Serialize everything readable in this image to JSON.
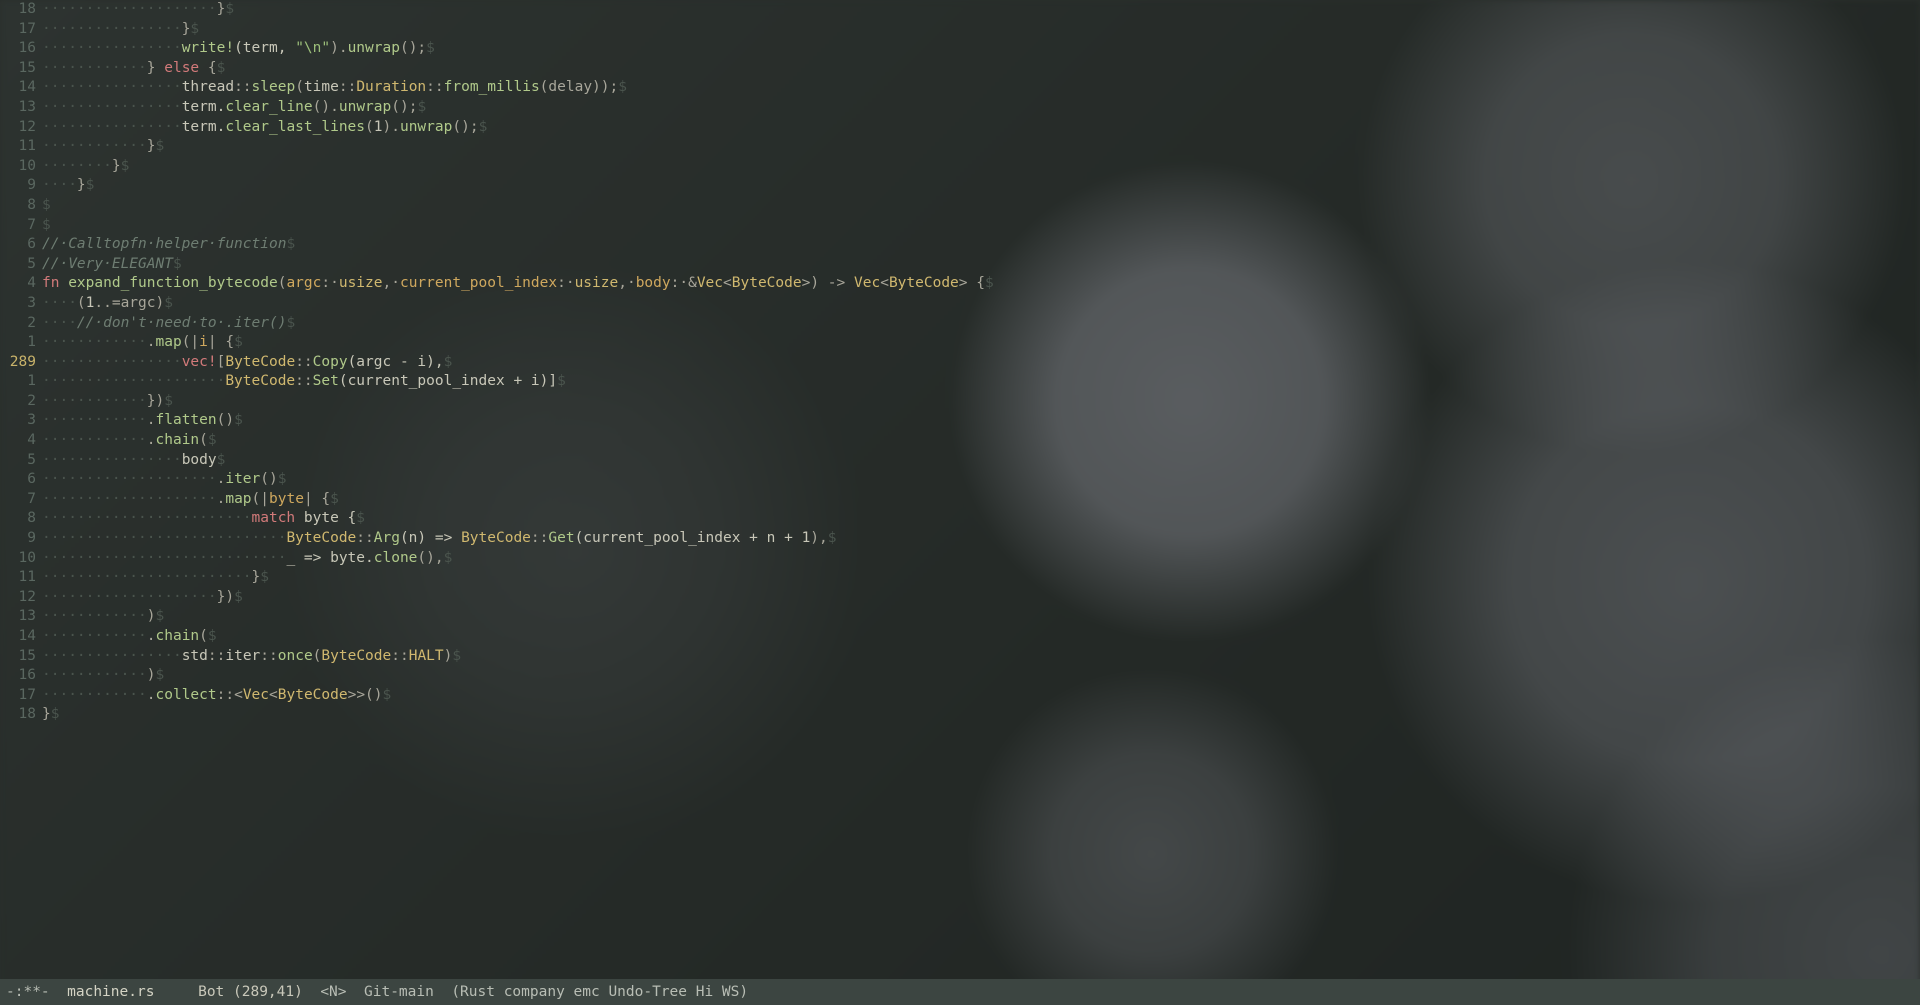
{
  "modeline": {
    "modified": "-:**-",
    "filename": "machine.rs",
    "position": "Bot (289,41)",
    "mode_indicator": "<N>",
    "vcs": "Git-main",
    "modes": "(Rust company emc Undo-Tree Hi WS)"
  },
  "cursor_line_number": "289",
  "lines": [
    {
      "rel": "18",
      "indent": 20,
      "tokens": [
        {
          "t": "}",
          "c": "punct"
        }
      ]
    },
    {
      "rel": "17",
      "indent": 16,
      "tokens": [
        {
          "t": "}",
          "c": "punct"
        }
      ]
    },
    {
      "rel": "16",
      "indent": 16,
      "tokens": [
        {
          "t": "write!",
          "c": "fnname"
        },
        {
          "t": "(term, ",
          "c": "plain"
        },
        {
          "t": "\"\\n\"",
          "c": "str"
        },
        {
          "t": ").",
          "c": "punct"
        },
        {
          "t": "unwrap",
          "c": "fnname"
        },
        {
          "t": "();",
          "c": "punct"
        }
      ]
    },
    {
      "rel": "15",
      "indent": 12,
      "tokens": [
        {
          "t": "} ",
          "c": "punct"
        },
        {
          "t": "else",
          "c": "kw"
        },
        {
          "t": " {",
          "c": "punct"
        }
      ]
    },
    {
      "rel": "14",
      "indent": 16,
      "tokens": [
        {
          "t": "thread",
          "c": "plain"
        },
        {
          "t": "::",
          "c": "punct"
        },
        {
          "t": "sleep",
          "c": "fnname"
        },
        {
          "t": "(",
          "c": "punct"
        },
        {
          "t": "time",
          "c": "plain"
        },
        {
          "t": "::",
          "c": "punct"
        },
        {
          "t": "Duration",
          "c": "ty"
        },
        {
          "t": "::",
          "c": "punct"
        },
        {
          "t": "from_millis",
          "c": "fnname"
        },
        {
          "t": "(delay));",
          "c": "punct"
        }
      ]
    },
    {
      "rel": "13",
      "indent": 16,
      "tokens": [
        {
          "t": "term.",
          "c": "plain"
        },
        {
          "t": "clear_line",
          "c": "fnname"
        },
        {
          "t": "().",
          "c": "punct"
        },
        {
          "t": "unwrap",
          "c": "fnname"
        },
        {
          "t": "();",
          "c": "punct"
        }
      ]
    },
    {
      "rel": "12",
      "indent": 16,
      "tokens": [
        {
          "t": "term.",
          "c": "plain"
        },
        {
          "t": "clear_last_lines",
          "c": "fnname"
        },
        {
          "t": "(",
          "c": "punct"
        },
        {
          "t": "1",
          "c": "num"
        },
        {
          "t": ").",
          "c": "punct"
        },
        {
          "t": "unwrap",
          "c": "fnname"
        },
        {
          "t": "();",
          "c": "punct"
        }
      ]
    },
    {
      "rel": "11",
      "indent": 12,
      "tokens": [
        {
          "t": "}",
          "c": "punct"
        }
      ]
    },
    {
      "rel": "10",
      "indent": 8,
      "tokens": [
        {
          "t": "}",
          "c": "punct"
        }
      ]
    },
    {
      "rel": "9",
      "indent": 4,
      "tokens": [
        {
          "t": "}",
          "c": "punct"
        }
      ]
    },
    {
      "rel": "8",
      "indent": 0,
      "tokens": []
    },
    {
      "rel": "7",
      "indent": 0,
      "tokens": []
    },
    {
      "rel": "6",
      "indent": 0,
      "tokens": [
        {
          "t": "// Calltopfn helper function",
          "c": "comment",
          "dotspaces": true
        }
      ]
    },
    {
      "rel": "5",
      "indent": 0,
      "tokens": [
        {
          "t": "// Very ELEGANT",
          "c": "comment",
          "dotspaces": true
        }
      ]
    },
    {
      "rel": "4",
      "indent": 0,
      "tokens": [
        {
          "t": "fn ",
          "c": "kw"
        },
        {
          "t": "expand_function_bytecode",
          "c": "fnname"
        },
        {
          "t": "(",
          "c": "punct"
        },
        {
          "t": "argc",
          "c": "param"
        },
        {
          "t": ": ",
          "c": "punct"
        },
        {
          "t": "usize",
          "c": "ty"
        },
        {
          "t": ", ",
          "c": "punct"
        },
        {
          "t": "current_pool_index",
          "c": "param"
        },
        {
          "t": ": ",
          "c": "punct"
        },
        {
          "t": "usize",
          "c": "ty"
        },
        {
          "t": ", ",
          "c": "punct"
        },
        {
          "t": "body",
          "c": "param"
        },
        {
          "t": ": &",
          "c": "punct"
        },
        {
          "t": "Vec",
          "c": "ty"
        },
        {
          "t": "<",
          "c": "punct"
        },
        {
          "t": "ByteCode",
          "c": "ty"
        },
        {
          "t": ">) -> ",
          "c": "punct"
        },
        {
          "t": "Vec",
          "c": "ty"
        },
        {
          "t": "<",
          "c": "punct"
        },
        {
          "t": "ByteCode",
          "c": "ty"
        },
        {
          "t": "> {",
          "c": "punct"
        }
      ],
      "dotspaces_after_punct": true
    },
    {
      "rel": "3",
      "indent": 4,
      "tokens": [
        {
          "t": "(",
          "c": "punct"
        },
        {
          "t": "1",
          "c": "num"
        },
        {
          "t": "..=argc)",
          "c": "punct"
        }
      ]
    },
    {
      "rel": "2",
      "indent": 4,
      "tokens": [
        {
          "t": "// don't need to .iter()",
          "c": "comment",
          "dotspaces": true
        }
      ]
    },
    {
      "rel": "1",
      "indent": 12,
      "tokens": [
        {
          "t": ".",
          "c": "punct"
        },
        {
          "t": "map",
          "c": "fnname"
        },
        {
          "t": "(|",
          "c": "punct"
        },
        {
          "t": "i",
          "c": "param"
        },
        {
          "t": "| {",
          "c": "punct"
        }
      ]
    },
    {
      "rel": "289",
      "curr": true,
      "indent": 16,
      "tokens": [
        {
          "t": "vec!",
          "c": "vecmacro"
        },
        {
          "t": "[",
          "c": "punct"
        },
        {
          "t": "ByteCode",
          "c": "ty"
        },
        {
          "t": "::",
          "c": "punct"
        },
        {
          "t": "Copy",
          "c": "fnname"
        },
        {
          "t": "(argc - i),",
          "c": "plain"
        }
      ]
    },
    {
      "rel": "1",
      "indent": 21,
      "tokens": [
        {
          "t": "ByteCode",
          "c": "ty"
        },
        {
          "t": "::",
          "c": "punct"
        },
        {
          "t": "Set",
          "c": "fnname"
        },
        {
          "t": "(current_pool_index + i)]",
          "c": "plain"
        }
      ]
    },
    {
      "rel": "2",
      "indent": 12,
      "tokens": [
        {
          "t": "})",
          "c": "punct"
        }
      ]
    },
    {
      "rel": "3",
      "indent": 12,
      "tokens": [
        {
          "t": ".",
          "c": "punct"
        },
        {
          "t": "flatten",
          "c": "fnname"
        },
        {
          "t": "()",
          "c": "punct"
        }
      ]
    },
    {
      "rel": "4",
      "indent": 12,
      "tokens": [
        {
          "t": ".",
          "c": "punct"
        },
        {
          "t": "chain",
          "c": "fnname"
        },
        {
          "t": "(",
          "c": "punct"
        }
      ]
    },
    {
      "rel": "5",
      "indent": 16,
      "tokens": [
        {
          "t": "body",
          "c": "plain"
        }
      ]
    },
    {
      "rel": "6",
      "indent": 20,
      "tokens": [
        {
          "t": ".",
          "c": "punct"
        },
        {
          "t": "iter",
          "c": "fnname"
        },
        {
          "t": "()",
          "c": "punct"
        }
      ]
    },
    {
      "rel": "7",
      "indent": 20,
      "tokens": [
        {
          "t": ".",
          "c": "punct"
        },
        {
          "t": "map",
          "c": "fnname"
        },
        {
          "t": "(|",
          "c": "punct"
        },
        {
          "t": "byte",
          "c": "param"
        },
        {
          "t": "| {",
          "c": "punct"
        }
      ]
    },
    {
      "rel": "8",
      "indent": 24,
      "tokens": [
        {
          "t": "match",
          "c": "kw"
        },
        {
          "t": " byte {",
          "c": "plain"
        }
      ]
    },
    {
      "rel": "9",
      "indent": 28,
      "tokens": [
        {
          "t": "ByteCode",
          "c": "ty"
        },
        {
          "t": "::",
          "c": "punct"
        },
        {
          "t": "Arg",
          "c": "fnname"
        },
        {
          "t": "(n) => ",
          "c": "plain"
        },
        {
          "t": "ByteCode",
          "c": "ty"
        },
        {
          "t": "::",
          "c": "punct"
        },
        {
          "t": "Get",
          "c": "fnname"
        },
        {
          "t": "(current_pool_index + n + ",
          "c": "plain"
        },
        {
          "t": "1",
          "c": "num"
        },
        {
          "t": "),",
          "c": "punct"
        }
      ]
    },
    {
      "rel": "10",
      "indent": 28,
      "tokens": [
        {
          "t": "_ => byte.",
          "c": "plain"
        },
        {
          "t": "clone",
          "c": "fnname"
        },
        {
          "t": "(),",
          "c": "punct"
        }
      ]
    },
    {
      "rel": "11",
      "indent": 24,
      "tokens": [
        {
          "t": "}",
          "c": "punct"
        }
      ]
    },
    {
      "rel": "12",
      "indent": 20,
      "tokens": [
        {
          "t": "})",
          "c": "punct"
        }
      ]
    },
    {
      "rel": "13",
      "indent": 12,
      "tokens": [
        {
          "t": ")",
          "c": "punct"
        }
      ]
    },
    {
      "rel": "14",
      "indent": 12,
      "tokens": [
        {
          "t": ".",
          "c": "punct"
        },
        {
          "t": "chain",
          "c": "fnname"
        },
        {
          "t": "(",
          "c": "punct"
        }
      ]
    },
    {
      "rel": "15",
      "indent": 16,
      "tokens": [
        {
          "t": "std",
          "c": "plain"
        },
        {
          "t": "::",
          "c": "punct"
        },
        {
          "t": "iter",
          "c": "plain"
        },
        {
          "t": "::",
          "c": "punct"
        },
        {
          "t": "once",
          "c": "fnname"
        },
        {
          "t": "(",
          "c": "punct"
        },
        {
          "t": "ByteCode",
          "c": "ty"
        },
        {
          "t": "::",
          "c": "punct"
        },
        {
          "t": "HALT",
          "c": "ty"
        },
        {
          "t": ")",
          "c": "punct"
        }
      ]
    },
    {
      "rel": "16",
      "indent": 12,
      "tokens": [
        {
          "t": ")",
          "c": "punct"
        }
      ]
    },
    {
      "rel": "17",
      "indent": 12,
      "tokens": [
        {
          "t": ".",
          "c": "punct"
        },
        {
          "t": "collect",
          "c": "fnname"
        },
        {
          "t": "::<",
          "c": "punct"
        },
        {
          "t": "Vec",
          "c": "ty"
        },
        {
          "t": "<",
          "c": "punct"
        },
        {
          "t": "ByteCode",
          "c": "ty"
        },
        {
          "t": ">>()",
          "c": "punct"
        }
      ]
    },
    {
      "rel": "18",
      "indent": 0,
      "tokens": [
        {
          "t": "}",
          "c": "punct"
        }
      ]
    }
  ]
}
